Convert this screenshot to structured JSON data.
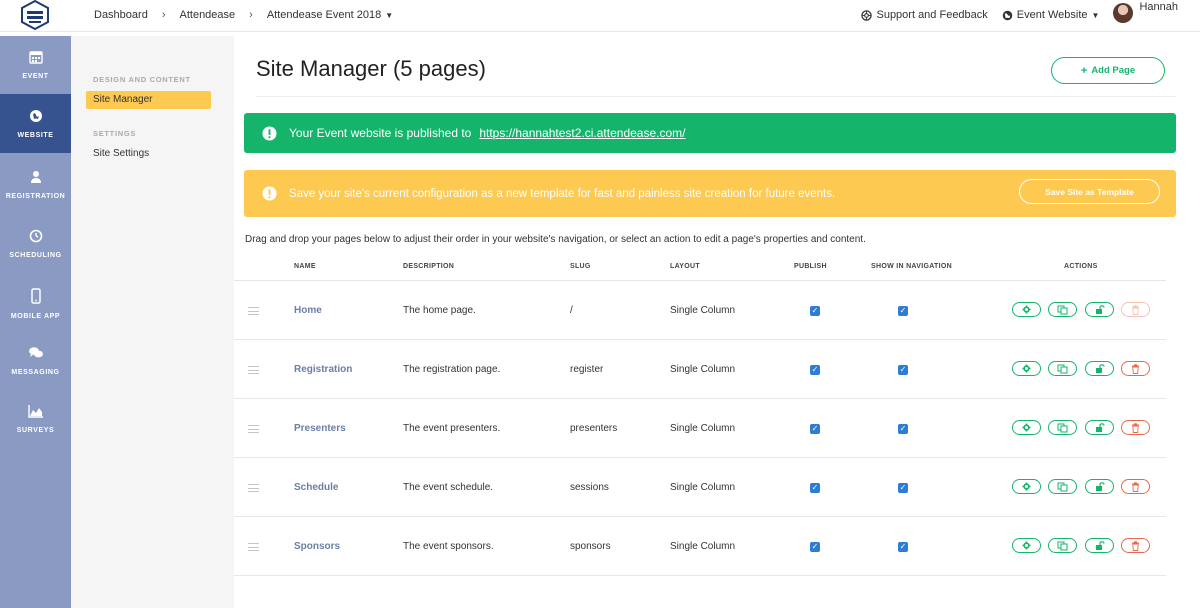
{
  "breadcrumb": {
    "items": [
      "Dashboard",
      "Attendease",
      "Attendease Event 2018"
    ]
  },
  "header_right": {
    "support_label": "Support and Feedback",
    "event_website_label": "Event Website",
    "user_name": "Hannah"
  },
  "left_nav": [
    {
      "label": "EVENT",
      "icon": "calendar-icon"
    },
    {
      "label": "WEBSITE",
      "icon": "globe-icon",
      "active": true
    },
    {
      "label": "REGISTRATION",
      "icon": "person-icon"
    },
    {
      "label": "SCHEDULING",
      "icon": "clock-icon"
    },
    {
      "label": "MOBILE APP",
      "icon": "mobile-icon"
    },
    {
      "label": "MESSAGING",
      "icon": "chat-icon"
    },
    {
      "label": "SURVEYS",
      "icon": "chart-icon"
    }
  ],
  "sidebar": {
    "section1_heading": "DESIGN AND CONTENT",
    "site_manager_label": "Site Manager",
    "section2_heading": "SETTINGS",
    "site_settings_label": "Site Settings"
  },
  "main": {
    "title": "Site Manager (5 pages)",
    "add_page_label": "Add Page",
    "published_text": "Your Event website is published to",
    "published_url": "https://hannahtest2.ci.attendease.com/",
    "template_text": "Save your site's current configuration as a new template for fast and painless site creation for future events.",
    "save_template_label": "Save Site as Template",
    "instructions": "Drag and drop your pages below to adjust their order in your website's navigation, or select an action to edit a page's properties and content."
  },
  "table": {
    "columns": [
      "NAME",
      "DESCRIPTION",
      "SLUG",
      "LAYOUT",
      "PUBLISH",
      "SHOW IN NAVIGATION",
      "ACTIONS"
    ],
    "rows": [
      {
        "name": "Home",
        "description": "The home page.",
        "slug": "/",
        "layout": "Single Column",
        "publish": true,
        "show_in_nav": true,
        "delete_enabled": false
      },
      {
        "name": "Registration",
        "description": "The registration page.",
        "slug": "register",
        "layout": "Single Column",
        "publish": true,
        "show_in_nav": true,
        "delete_enabled": true
      },
      {
        "name": "Presenters",
        "description": "The event presenters.",
        "slug": "presenters",
        "layout": "Single Column",
        "publish": true,
        "show_in_nav": true,
        "delete_enabled": true
      },
      {
        "name": "Schedule",
        "description": "The event schedule.",
        "slug": "sessions",
        "layout": "Single Column",
        "publish": true,
        "show_in_nav": true,
        "delete_enabled": true
      },
      {
        "name": "Sponsors",
        "description": "The event sponsors.",
        "slug": "sponsors",
        "layout": "Single Column",
        "publish": true,
        "show_in_nav": true,
        "delete_enabled": true
      }
    ]
  },
  "colors": {
    "green": "#15b46b",
    "yellow": "#fdc951",
    "nav_bg": "#8a9ac3",
    "nav_active": "#36538f",
    "red": "#e8694a"
  }
}
